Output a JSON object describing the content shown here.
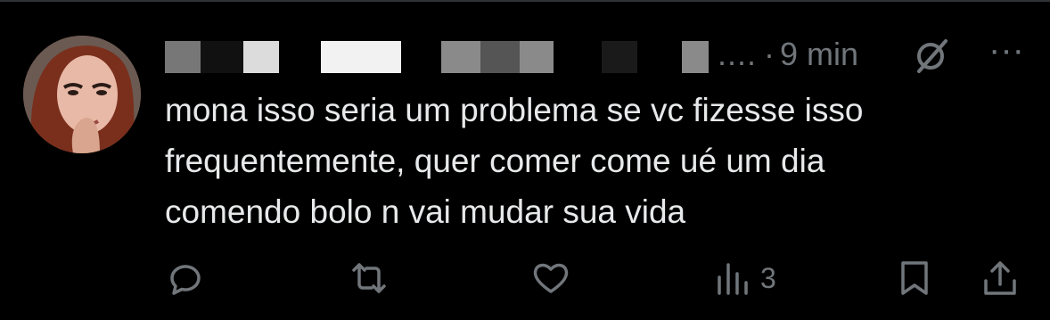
{
  "post": {
    "author_name_obscured": true,
    "name_truncation": "....",
    "time": "9 min",
    "time_separator": "·",
    "more_glyph": "···",
    "text": "mona isso seria um problema se vc fizesse isso\nfrequentemente, quer comer come ué um dia\ncomendo bolo n vai mudar sua vida"
  },
  "actions": {
    "reply": {
      "icon": "reply-icon"
    },
    "repost": {
      "icon": "repost-icon"
    },
    "like": {
      "icon": "heart-icon"
    },
    "views": {
      "icon": "views-icon",
      "count": "3"
    },
    "bookmark": {
      "icon": "bookmark-icon"
    },
    "share": {
      "icon": "share-icon"
    }
  },
  "colors": {
    "background": "#000000",
    "text": "#e7e9ea",
    "muted": "#71767b"
  }
}
